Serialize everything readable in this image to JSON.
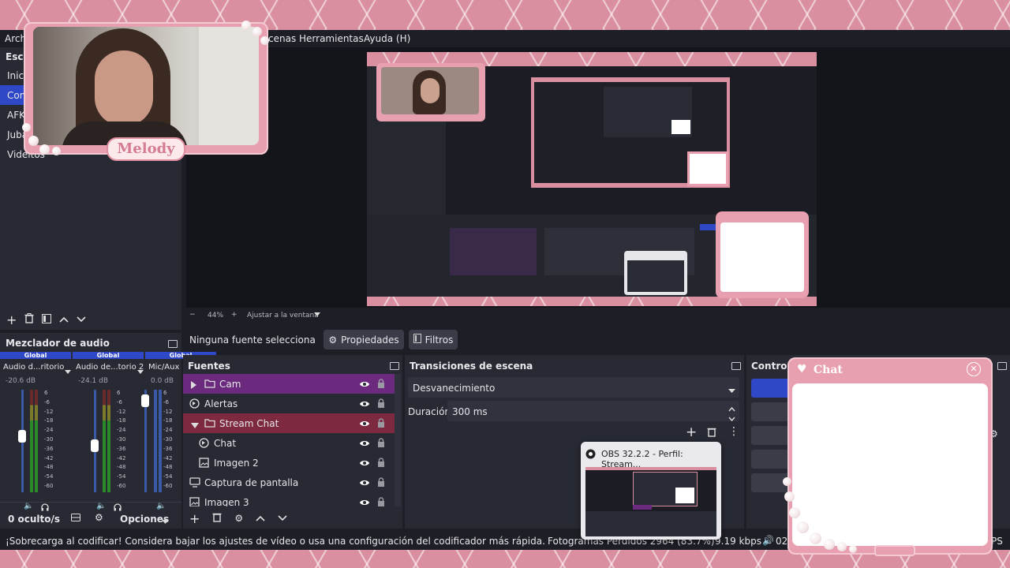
{
  "menu": {
    "items": [
      "Arch",
      "cenas",
      "Herramientas",
      "Ayuda (H)"
    ]
  },
  "scenes": {
    "title": "Esce",
    "items": [
      "Inici",
      "Con",
      "AFK",
      "Juba",
      "Videitos"
    ],
    "selected_index": 1
  },
  "webcam": {
    "name_label": "Melody"
  },
  "preview_bar": {
    "zoom_minus": "−",
    "zoom_value": "44%",
    "zoom_plus": "+",
    "fit_label": "Ajustar a la ventana"
  },
  "source_bar": {
    "no_source": "Ninguna fuente selecciona",
    "properties": "Propiedades",
    "filters": "Filtros"
  },
  "mixer": {
    "title": "Mezclador de audio",
    "channels": [
      {
        "badge": "Global",
        "name": "Audio d...ritorio",
        "db": "-20.6 dB",
        "level": 0.55
      },
      {
        "badge": "Global",
        "name": "Audio de...torio 2",
        "db": "-24.1 dB",
        "level": 0.45
      },
      {
        "badge": "Global",
        "name": "Mic/Aux",
        "db": "0.0 dB",
        "level": 0.95
      }
    ],
    "scale": [
      "6",
      "-6",
      "-12",
      "-18",
      "-24",
      "-30",
      "-36",
      "-42",
      "-48",
      "-54",
      "-60"
    ],
    "hidden_count": "0 oculto/s",
    "options": "Opciones"
  },
  "sources": {
    "title": "Fuentes",
    "items": [
      {
        "label": "Cam",
        "type": "folder",
        "state": "selected-purple",
        "expander": "right"
      },
      {
        "label": "Alertas",
        "type": "browser",
        "state": "normal",
        "expander": ""
      },
      {
        "label": "Stream Chat",
        "type": "folder",
        "state": "selected-red",
        "expander": "down"
      },
      {
        "label": "Chat",
        "type": "browser",
        "state": "child",
        "expander": ""
      },
      {
        "label": "Imagen 2",
        "type": "image",
        "state": "child",
        "expander": ""
      },
      {
        "label": "Captura de pantalla",
        "type": "monitor",
        "state": "normal",
        "expander": ""
      },
      {
        "label": "Imagen 3",
        "type": "image",
        "state": "normal",
        "expander": ""
      }
    ]
  },
  "transitions": {
    "title": "Transiciones de escena",
    "selected": "Desvanecimiento",
    "duration_label": "Duración",
    "duration_value": "300 ms"
  },
  "controls": {
    "title": "Controle"
  },
  "chat_overlay": {
    "title": "Chat"
  },
  "taskbar_thumb": {
    "title": "OBS 32.2.2 - Perfil: Stream..."
  },
  "status": {
    "message": "¡Sobrecarga al codificar! Considera bajar los ajustes de vídeo o usa una configuración del codificador más rápida.",
    "frames": "Fotogramas Perdidos 2964 (83.7%)",
    "kbps": "9.19 kbps",
    "time": "02:",
    "fps": "PS"
  },
  "colors": {
    "accent_blue": "#2f48c8",
    "source_purple": "#6b2a7d",
    "source_red": "#7d2a40",
    "pink_frame": "#e8a0b0"
  }
}
